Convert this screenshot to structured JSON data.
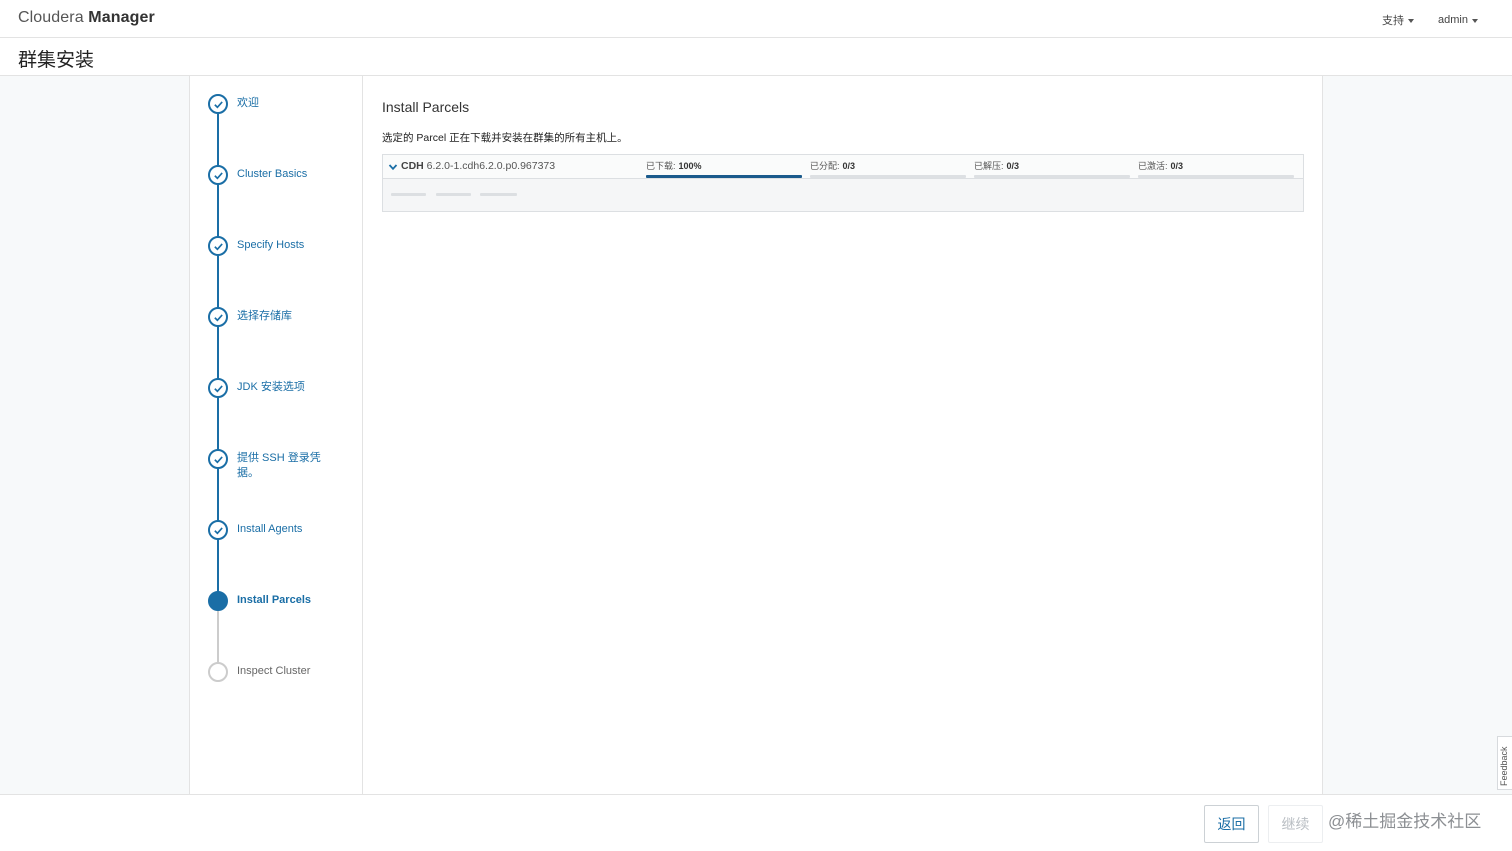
{
  "header": {
    "brand_light": "Cloudera",
    "brand_bold": "Manager",
    "nav": [
      {
        "label": "支持"
      },
      {
        "label": "admin"
      }
    ]
  },
  "page": {
    "title": "群集安装"
  },
  "steps": [
    {
      "label": "欢迎",
      "state": "done"
    },
    {
      "label": "Cluster Basics",
      "state": "done"
    },
    {
      "label": "Specify Hosts",
      "state": "done"
    },
    {
      "label": "选择存储库",
      "state": "done"
    },
    {
      "label": "JDK 安装选项",
      "state": "done"
    },
    {
      "label": "提供 SSH 登录凭据。",
      "state": "done"
    },
    {
      "label": "Install Agents",
      "state": "done"
    },
    {
      "label": "Install Parcels",
      "state": "active"
    },
    {
      "label": "Inspect Cluster",
      "state": "pending"
    }
  ],
  "main": {
    "section_title": "Install Parcels",
    "description": "选定的 Parcel 正在下载并安装在群集的所有主机上。",
    "parcel": {
      "name": "CDH",
      "version": "6.2.0-1.cdh6.2.0.p0.967373",
      "stages": [
        {
          "label": "已下载:",
          "value": "100%",
          "progress": 1.0
        },
        {
          "label": "已分配:",
          "value": "0/3",
          "progress": 0.0
        },
        {
          "label": "已解压:",
          "value": "0/3",
          "progress": 0.0
        },
        {
          "label": "已激活:",
          "value": "0/3",
          "progress": 0.0
        }
      ]
    }
  },
  "footer": {
    "back_label": "返回",
    "continue_label": "继续",
    "watermark": "@稀土掘金技术社区"
  },
  "feedback_label": "Feedback",
  "colors": {
    "accent": "#1a6ea6",
    "progress_fill": "#1a5a8c",
    "pending": "#cccccc"
  }
}
